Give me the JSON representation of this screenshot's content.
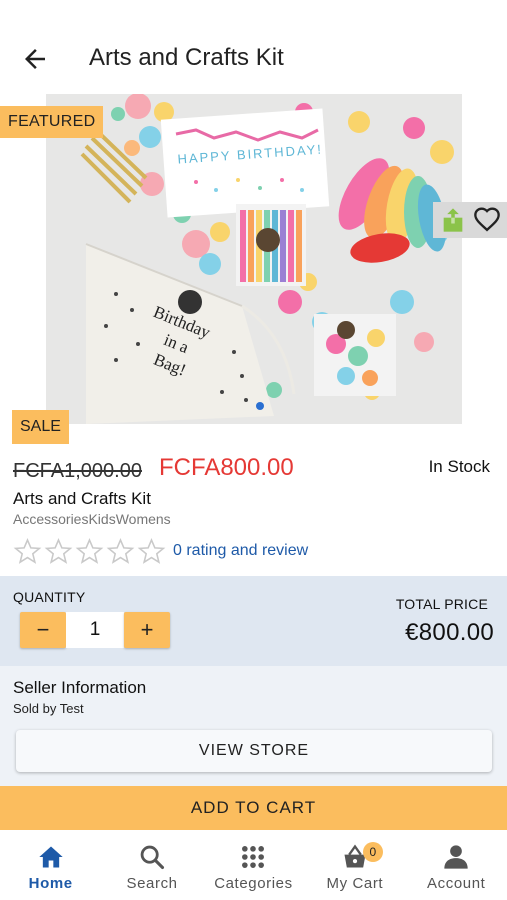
{
  "appbar": {
    "title": "Arts and Crafts Kit"
  },
  "badges": {
    "featured": "FEATURED",
    "sale": "SALE"
  },
  "product": {
    "old_price": "FCFA1,000.00",
    "new_price": "FCFA800.00",
    "stock": "In Stock",
    "name": "Arts and Crafts Kit",
    "categories": "AccessoriesKidsWomens",
    "rating_stars": 0,
    "rating_link": "0 rating and review"
  },
  "photo_text": {
    "banner": "HAPPY BIRTHDAY!",
    "bag_lines": [
      "Birthday",
      "in a",
      "Bag!"
    ]
  },
  "quantity": {
    "label": "QUANTITY",
    "value": "1",
    "minus": "−",
    "plus": "+"
  },
  "total": {
    "label": "TOTAL PRICE",
    "value": "€800.00"
  },
  "seller": {
    "title": "Seller Information",
    "sold_by": "Sold by Test",
    "view_store": "VIEW STORE"
  },
  "cart": {
    "add_label": "ADD TO CART"
  },
  "nav": {
    "items": [
      {
        "label": "Home",
        "icon": "home-icon",
        "active": true
      },
      {
        "label": "Search",
        "icon": "search-icon"
      },
      {
        "label": "Categories",
        "icon": "grid-icon"
      },
      {
        "label": "My Cart",
        "icon": "basket-icon",
        "badge": "0"
      },
      {
        "label": "Account",
        "icon": "person-icon"
      }
    ]
  },
  "colors": {
    "accent": "#fbbd5e",
    "sale_red": "#e53935",
    "link_blue": "#1e5aa8",
    "qty_bg": "#dfe7f1",
    "seller_bg": "#eef2f7"
  }
}
